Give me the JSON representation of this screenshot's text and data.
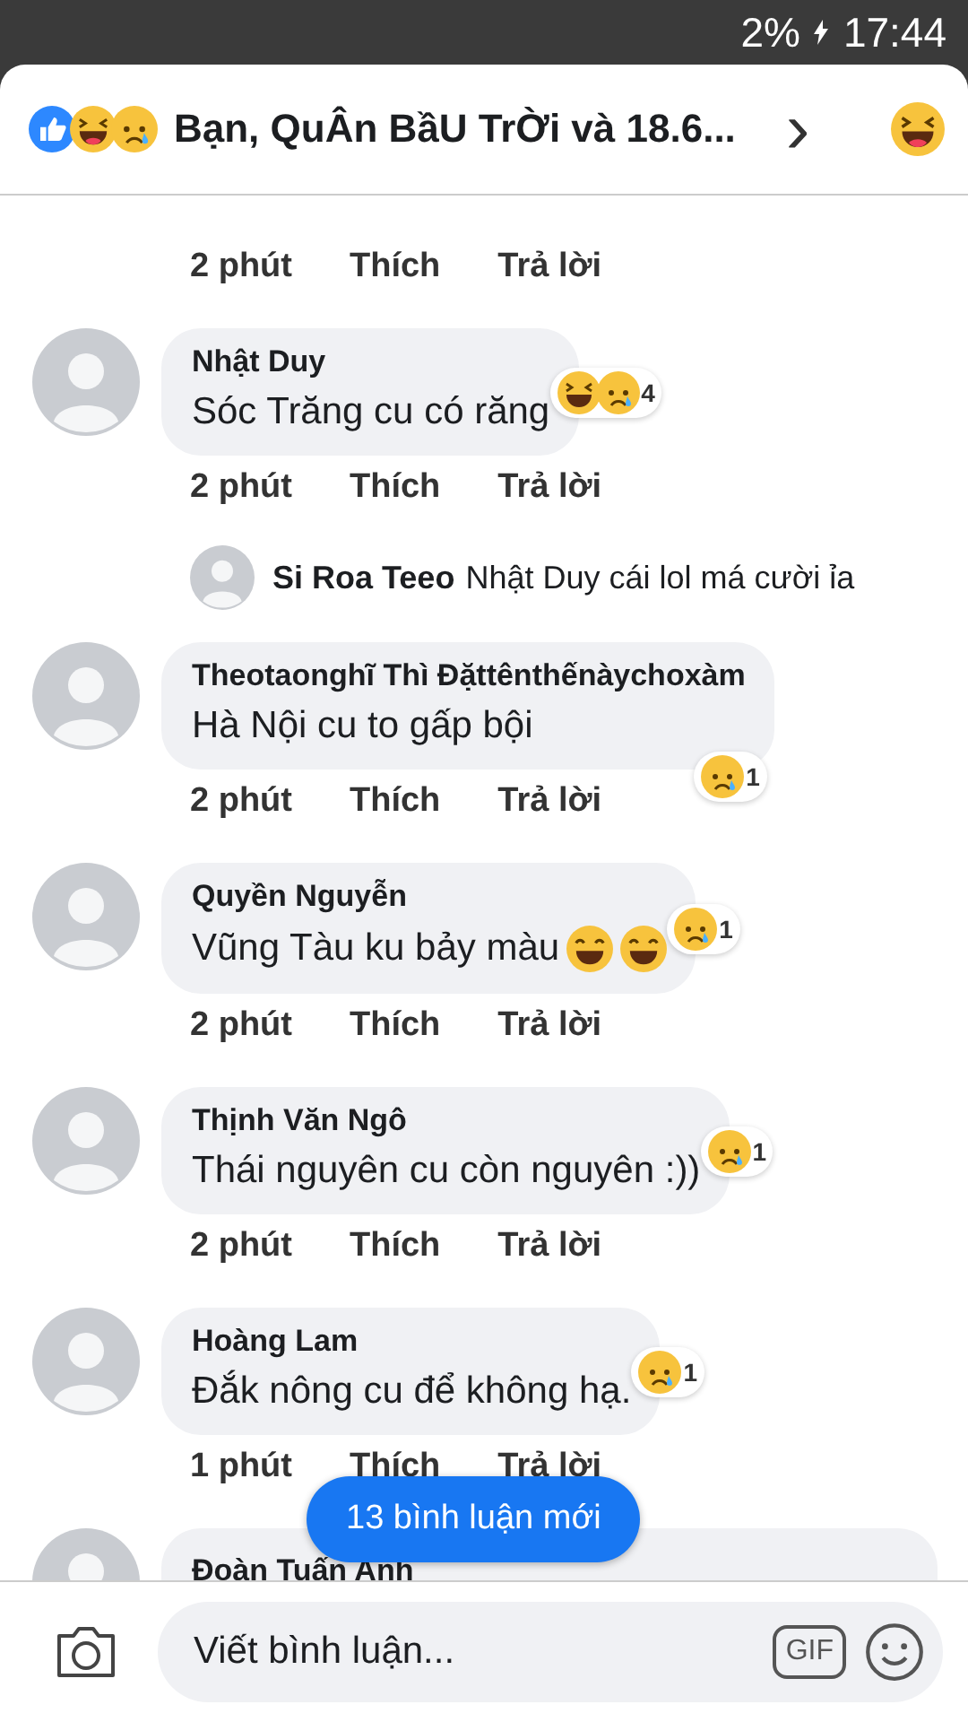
{
  "status_bar": {
    "battery": "2%",
    "time": "17:44"
  },
  "header": {
    "reactions": [
      {
        "kind": "like"
      },
      {
        "kind": "haha"
      },
      {
        "kind": "sad"
      }
    ],
    "title": "Bạn, QuÂn BầU TrỜi và 18.6...",
    "chevron": "›",
    "own_reaction": {
      "kind": "haha"
    }
  },
  "comments": [
    {
      "kind": "actions_only",
      "time": "2 phút",
      "like": "Thích",
      "reply": "Trả lời"
    },
    {
      "kind": "comment",
      "name": "Nhật Duy",
      "text": "Sóc Trăng cu có răng",
      "reactions": [
        {
          "kind": "haha"
        },
        {
          "kind": "sad"
        }
      ],
      "reaction_count": "4",
      "badge_below": false,
      "time": "2 phút",
      "like": "Thích",
      "reply": "Trả lời",
      "replies": [
        {
          "name": "Si Roa Teeo",
          "text": "Nhật Duy cái lol má cười ỉa"
        }
      ]
    },
    {
      "kind": "comment",
      "name": "Theotaonghĩ Thì Đặttênthếnàychoxàm",
      "text": "Hà Nội cu to gấp bội",
      "reactions": [
        {
          "kind": "sad"
        }
      ],
      "reaction_count": "1",
      "badge_below": true,
      "time": "2 phút",
      "like": "Thích",
      "reply": "Trả lời"
    },
    {
      "kind": "comment",
      "name": "Quyền Nguyễn",
      "text": "Vũng Tàu ku bảy màu",
      "text_emojis": [
        {
          "kind": "sweat_smile"
        },
        {
          "kind": "sweat_smile"
        }
      ],
      "reactions": [
        {
          "kind": "sad"
        }
      ],
      "reaction_count": "1",
      "badge_below": false,
      "time": "2 phút",
      "like": "Thích",
      "reply": "Trả lời"
    },
    {
      "kind": "comment",
      "name": "Thịnh Văn Ngô",
      "text": "Thái nguyên cu còn nguyên :))",
      "reactions": [
        {
          "kind": "sad"
        }
      ],
      "reaction_count": "1",
      "badge_below": false,
      "time": "2 phút",
      "like": "Thích",
      "reply": "Trả lời"
    },
    {
      "kind": "comment",
      "name": "Hoàng Lam",
      "text": "Đắk nông cu để không hạ.",
      "reactions": [
        {
          "kind": "sad"
        }
      ],
      "reaction_count": "1",
      "badge_below": false,
      "time": "1 phút",
      "like": "Thích",
      "reply": "Trả lời"
    },
    {
      "kind": "name_only",
      "name": "Đoàn Tuấn Anh"
    }
  ],
  "new_comments_button": "13 bình luận mới",
  "composer": {
    "placeholder": "Viết bình luận...",
    "gif": "GIF"
  }
}
